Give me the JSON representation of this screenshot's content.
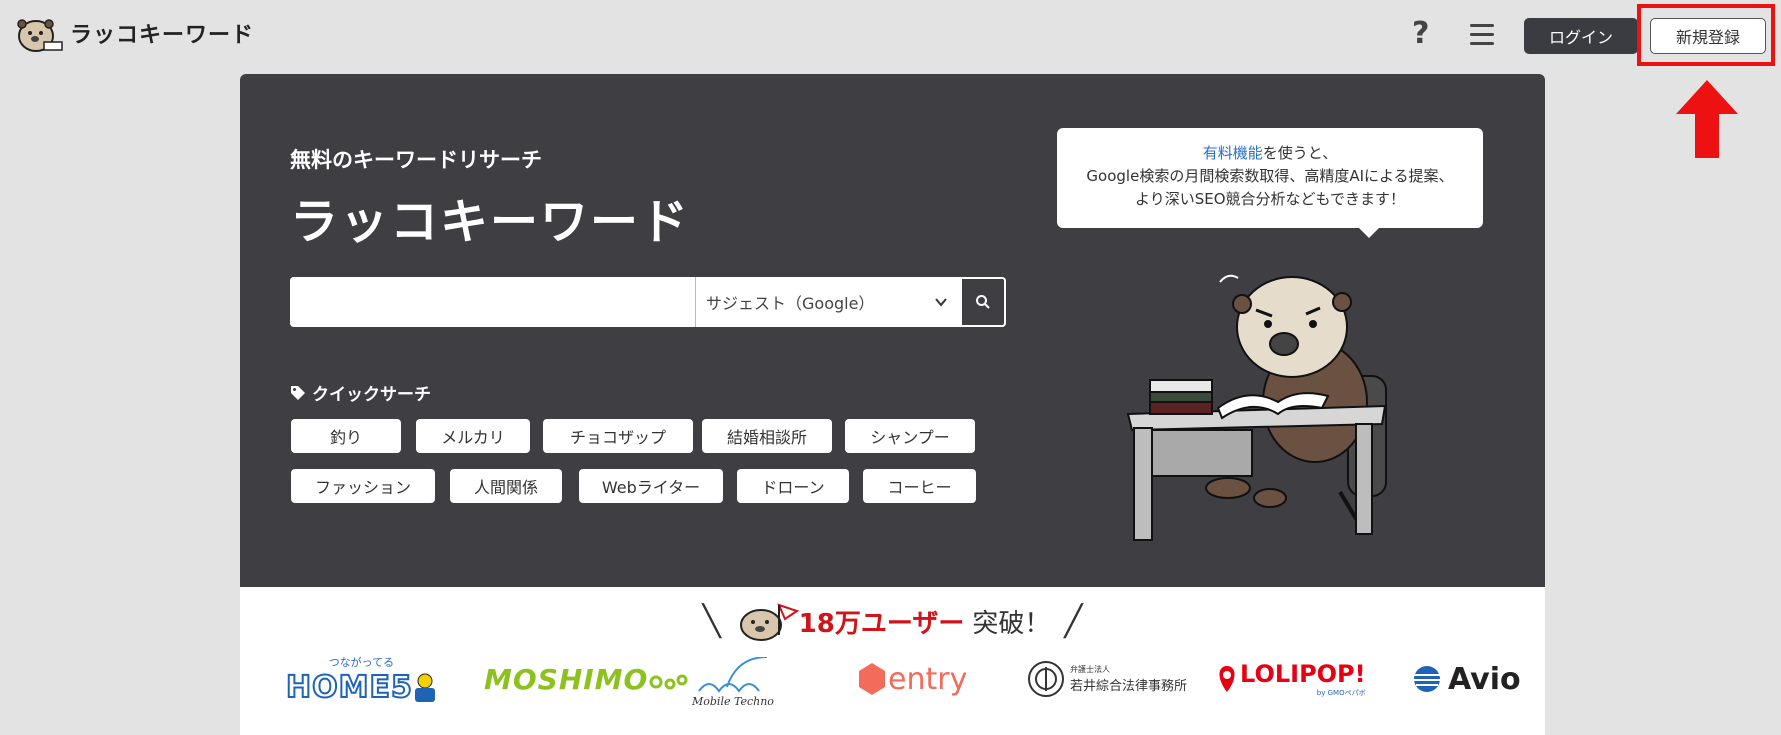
{
  "header": {
    "logo_text": "ラッコキーワード",
    "help_icon": "?",
    "login_label": "ログイン",
    "signup_label": "新規登録"
  },
  "hero": {
    "subtitle": "無料のキーワードリサーチ",
    "title": "ラッコキーワード",
    "search": {
      "value": "",
      "placeholder": "",
      "selected_mode": "サジェスト（Google）"
    },
    "quick_search_label": "クイックサーチ",
    "chips": [
      "釣り",
      "メルカリ",
      "チョコザップ",
      "結婚相談所",
      "シャンプー",
      "ファッション",
      "人間関係",
      "Webライター",
      "ドローン",
      "コーヒー"
    ],
    "bubble": {
      "link_text": "有料機能",
      "line1_rest": "を使うと、",
      "line2": "Google検索の月間検索数取得、高精度AIによる提案、",
      "line3": "より深いSEO競合分析などもできます！"
    }
  },
  "users": {
    "count_text": "18万ユーザー",
    "suffix": "突破！",
    "logos": {
      "home5_small": "つながってる",
      "home5": "HOME5",
      "moshimo": "MOSHIMO",
      "mobile_techno": "Mobile Techno",
      "entry": "entry",
      "wakai_small": "弁護士法人",
      "wakai": "若井綜合法律事務所",
      "lolipop": "LOLIPOP!",
      "lolipop_small": "by GMOペパボ",
      "avio": "Avio"
    }
  },
  "colors": {
    "hero_bg": "#3e3e43",
    "highlight": "#ee1111",
    "accent_red": "#d0141c",
    "link": "#2a6fc9"
  }
}
